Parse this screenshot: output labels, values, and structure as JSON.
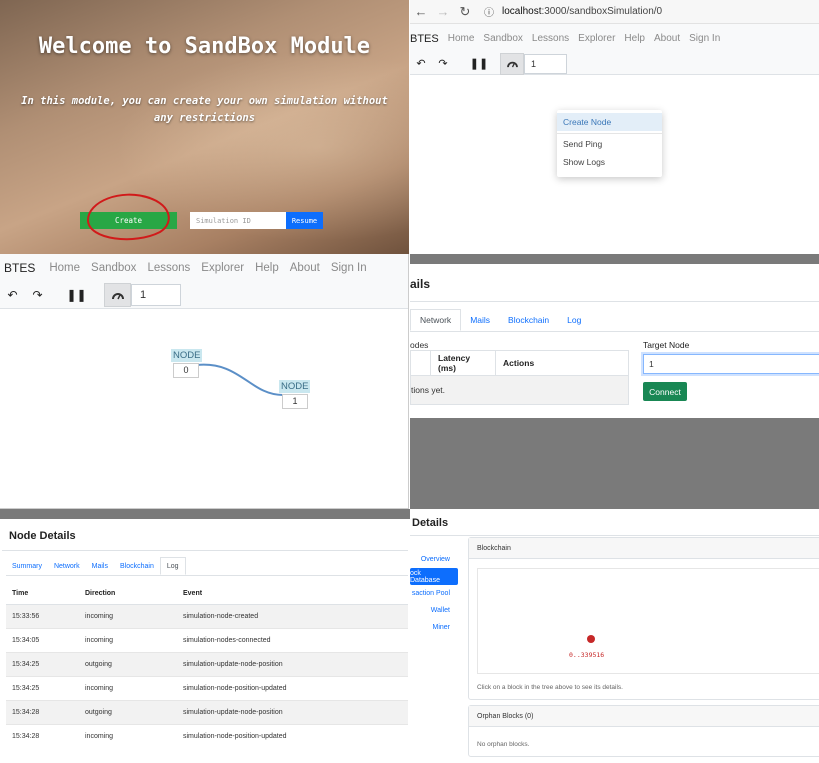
{
  "welcome": {
    "title": "Welcome to SandBox Module",
    "subtitle": "In this module, you can create your own simulation without any restrictions",
    "create_label": "Create",
    "sim_id_placeholder": "Simulation ID",
    "resume_label": "Resume"
  },
  "browser": {
    "url_host": "localhost",
    "url_path": ":3000/sandboxSimulation/0"
  },
  "nav": {
    "brand": "BTES",
    "links": [
      "Home",
      "Sandbox",
      "Lessons",
      "Explorer",
      "Help",
      "About",
      "Sign In"
    ]
  },
  "toolbar": {
    "speed": "1"
  },
  "context_menu": [
    "Create Node",
    "Send Ping",
    "Show Logs"
  ],
  "graph": {
    "nodes": [
      {
        "label": "NODE",
        "id": "0"
      },
      {
        "label": "NODE",
        "id": "1"
      }
    ]
  },
  "network_panel": {
    "title": "ails",
    "tabs": [
      "Network",
      "Mails",
      "Blockchain",
      "Log"
    ],
    "nodes_caption": "odes",
    "columns": [
      "",
      "Latency (ms)",
      "Actions"
    ],
    "empty_text": "tions yet.",
    "target_label": "Target Node",
    "target_value": "1",
    "connect_label": "Connect"
  },
  "log_panel": {
    "title": "Node Details",
    "tabs": [
      "Summary",
      "Network",
      "Mails",
      "Blockchain",
      "Log"
    ],
    "columns": [
      "Time",
      "Direction",
      "Event"
    ],
    "rows": [
      {
        "time": "15:33:56",
        "direction": "incoming",
        "event": "simulation-node-created"
      },
      {
        "time": "15:34:05",
        "direction": "incoming",
        "event": "simulation-nodes-connected"
      },
      {
        "time": "15:34:25",
        "direction": "outgoing",
        "event": "simulation-update-node-position"
      },
      {
        "time": "15:34:25",
        "direction": "incoming",
        "event": "simulation-node-position-updated"
      },
      {
        "time": "15:34:28",
        "direction": "outgoing",
        "event": "simulation-update-node-position"
      },
      {
        "time": "15:34:28",
        "direction": "incoming",
        "event": "simulation-node-position-updated"
      }
    ]
  },
  "blockdb_panel": {
    "title": "Details",
    "tree": [
      "Overview",
      "ock Database",
      "saction Pool",
      "Wallet",
      "Miner"
    ],
    "blockchain_header": "Blockchain",
    "block_hash": "0..339516",
    "hint": "Click on a block in the tree above to see its details.",
    "orphan_header": "Orphan Blocks (0)",
    "orphan_text": "No orphan blocks."
  },
  "colors": {
    "create_green": "#28a745",
    "resume_blue": "#0d6efd",
    "connect_green": "#198754",
    "block_red": "#c62828",
    "annotation_red": "#d11a1a",
    "edge_blue": "#5b8fc7"
  }
}
